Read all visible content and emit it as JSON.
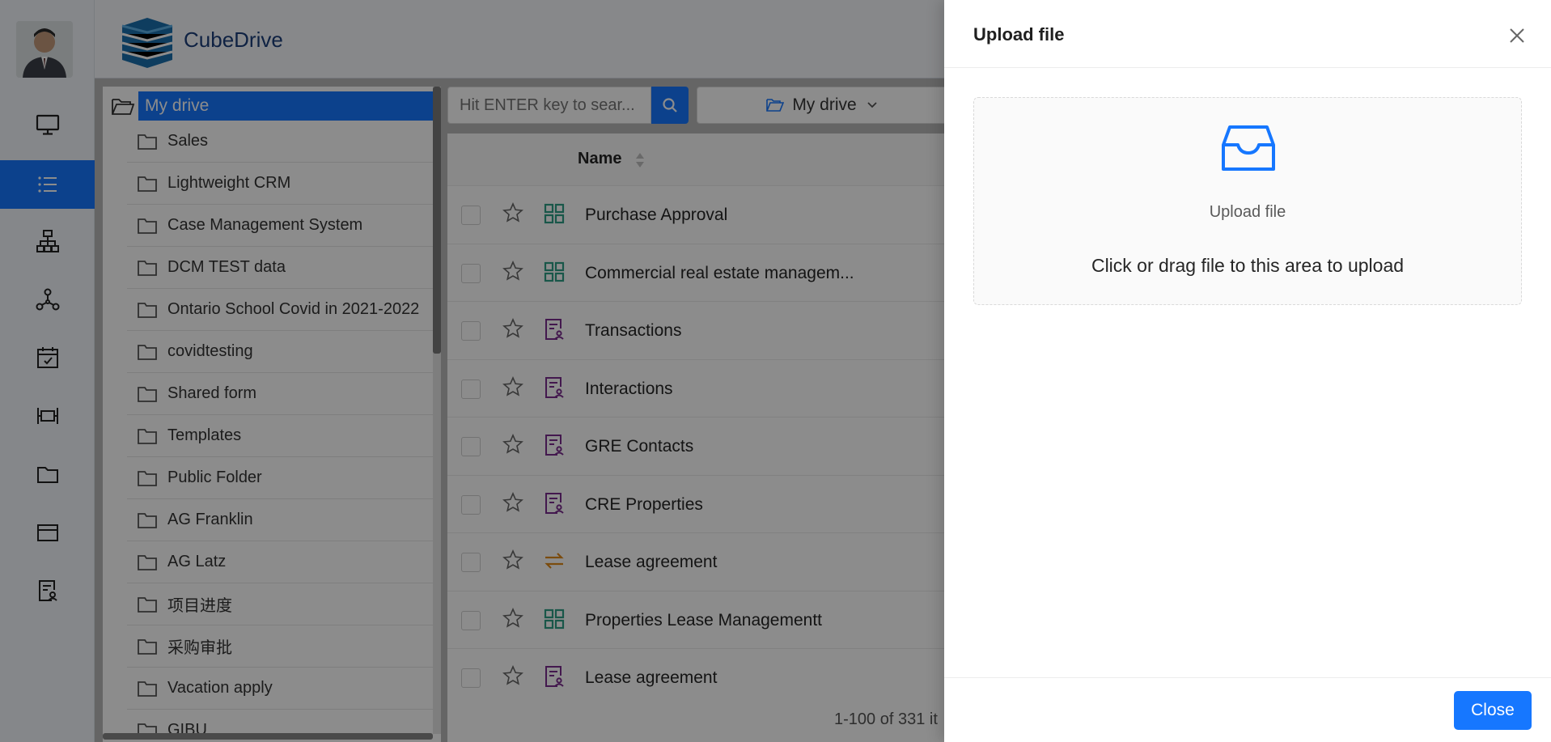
{
  "app": {
    "brand": "CubeDrive"
  },
  "sidebar": {
    "items": [
      {
        "icon": "desktop-icon",
        "active": false
      },
      {
        "icon": "list-icon",
        "active": true
      },
      {
        "icon": "org-chart-icon",
        "active": false
      },
      {
        "icon": "network-icon",
        "active": false
      },
      {
        "icon": "calendar-check-icon",
        "active": false
      },
      {
        "icon": "gantt-icon",
        "active": false
      },
      {
        "icon": "folder-icon",
        "active": false
      },
      {
        "icon": "card-icon",
        "active": false
      },
      {
        "icon": "form-user-icon",
        "active": false
      }
    ]
  },
  "tree": {
    "root": "My drive",
    "items": [
      "Sales",
      "Lightweight CRM",
      "Case Management System",
      "DCM TEST data",
      "Ontario School Covid in 2021-2022",
      "covidtesting",
      "Shared form",
      "Templates",
      "Public Folder",
      "AG Franklin",
      "AG Latz",
      "项目进度",
      "采购审批",
      "Vacation apply",
      "GIBU"
    ]
  },
  "search": {
    "placeholder": "Hit ENTER key to sear..."
  },
  "breadcrumb": {
    "label": "My drive"
  },
  "table": {
    "column_name": "Name",
    "rows": [
      {
        "name": "Purchase Approval",
        "type": "grid"
      },
      {
        "name": "Commercial real estate managem...",
        "type": "grid"
      },
      {
        "name": "Transactions",
        "type": "form"
      },
      {
        "name": "Interactions",
        "type": "form"
      },
      {
        "name": "GRE Contacts",
        "type": "form"
      },
      {
        "name": "CRE Properties",
        "type": "form"
      },
      {
        "name": "Lease agreement",
        "type": "flow"
      },
      {
        "name": "Properties Lease Managementt",
        "type": "grid"
      },
      {
        "name": "Lease agreement",
        "type": "form"
      }
    ],
    "pagination": "1-100 of 331 it"
  },
  "drawer": {
    "title": "Upload file",
    "dropzone_title": "Upload file",
    "dropzone_hint": "Click or drag file to this area to upload",
    "close_label": "Close"
  },
  "colors": {
    "accent": "#1677ff",
    "grid_icon": "#2e9f86",
    "form_icon": "#7b2d8e",
    "flow_icon": "#e08a1a"
  }
}
